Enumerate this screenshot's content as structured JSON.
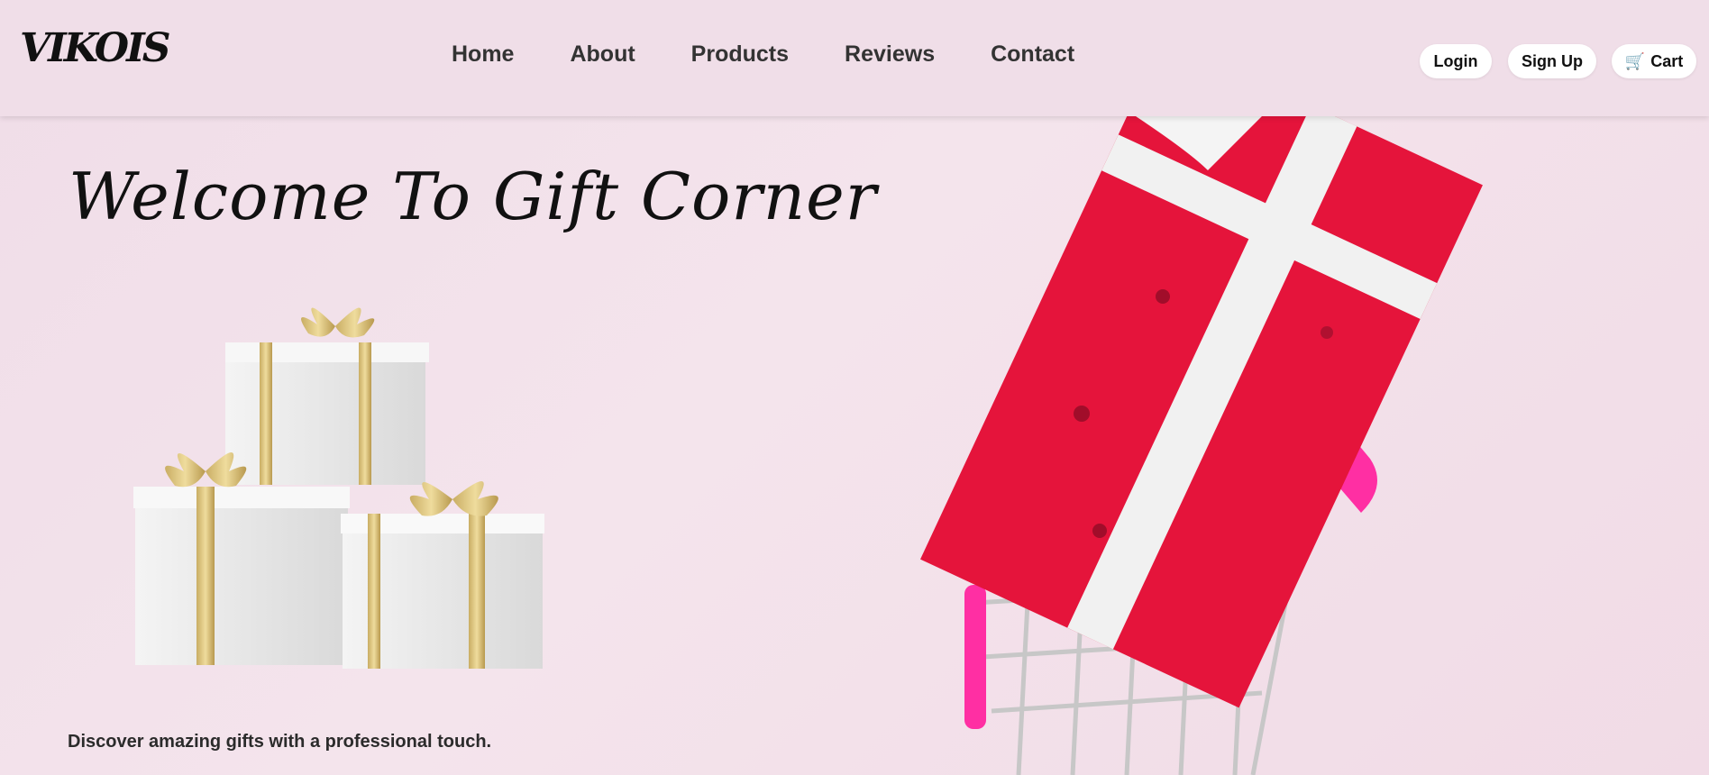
{
  "header": {
    "logo": "VIKOIS",
    "nav": [
      "Home",
      "About",
      "Products",
      "Reviews",
      "Contact"
    ],
    "login_label": "Login",
    "signup_label": "Sign Up",
    "cart_label": "Cart",
    "cart_icon": "shopping-cart-icon"
  },
  "hero": {
    "title": "Welcome To Gift Corner",
    "tagline": "Discover amazing gifts with a professional touch."
  },
  "colors": {
    "background": "#f1dfe8",
    "gift_red": "#e5143b",
    "ribbon_gold": "#d8bf7a",
    "cart_pink": "#ff2fa3"
  }
}
